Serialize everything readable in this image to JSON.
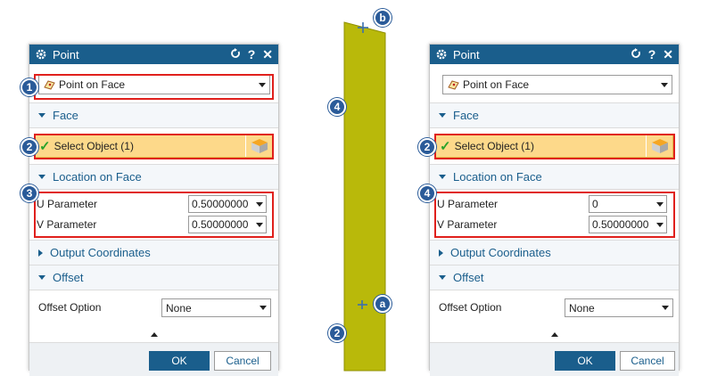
{
  "colors": {
    "titlebar": "#1a5e8c",
    "section_text": "#1a5e8c",
    "selection_fill": "#fdd98a",
    "highlight_border": "#e0201c",
    "badge_fill": "#2a5b99",
    "face_fill": "#b9b90a"
  },
  "left_dialog": {
    "title": "Point",
    "icons": [
      "gear-icon",
      "reset-icon",
      "help-icon",
      "close-icon"
    ],
    "help_label": "?",
    "close_label": "✕",
    "type_value": "Point on Face",
    "face_section": "Face",
    "select_label": "Select Object (1)",
    "location_section": "Location on Face",
    "u_label": "U Parameter",
    "u_value": "0.50000000",
    "v_label": "V Parameter",
    "v_value": "0.50000000",
    "output_section": "Output Coordinates",
    "offset_section": "Offset",
    "offset_label": "Offset Option",
    "offset_value": "None",
    "ok_label": "OK",
    "cancel_label": "Cancel"
  },
  "right_dialog": {
    "title": "Point",
    "help_label": "?",
    "close_label": "✕",
    "type_value": "Point on Face",
    "face_section": "Face",
    "select_label": "Select Object (1)",
    "location_section": "Location on Face",
    "u_label": "U Parameter",
    "u_value": "0",
    "v_label": "V Parameter",
    "v_value": "0.50000000",
    "output_section": "Output Coordinates",
    "offset_section": "Offset",
    "offset_label": "Offset Option",
    "offset_value": "None",
    "ok_label": "OK",
    "cancel_label": "Cancel"
  },
  "callouts": {
    "left_type": "1",
    "left_select": "2",
    "left_location": "3",
    "face_top": "4",
    "face_bottom": "2",
    "point_a": "a",
    "point_b": "b",
    "right_select": "2",
    "right_location": "4"
  }
}
